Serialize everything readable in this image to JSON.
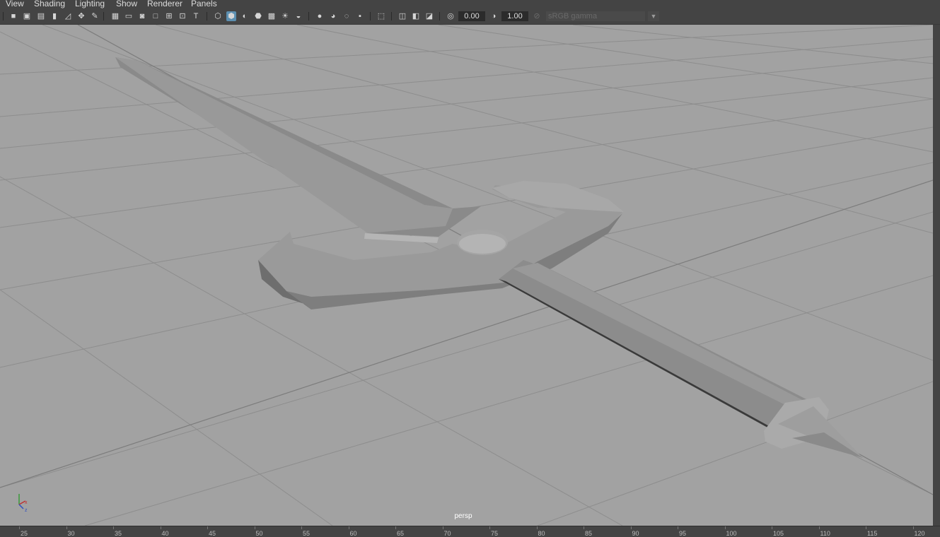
{
  "menu": {
    "view": "View",
    "shading": "Shading",
    "lighting": "Lighting",
    "show": "Show",
    "renderer": "Renderer",
    "panels": "Panels"
  },
  "toolbar": {
    "exposure_value": "0.00",
    "gamma_value": "1.00",
    "color_space": "sRGB gamma",
    "active_colors": {
      "highlight": "#5c8fb0"
    }
  },
  "viewport": {
    "camera_label": "persp",
    "background": "#a2a2a2",
    "axis_labels": {
      "x": "x",
      "y": "y",
      "z": "z"
    }
  },
  "timeline": {
    "ticks": [
      "25",
      "30",
      "35",
      "40",
      "45",
      "50",
      "55",
      "60",
      "65",
      "70",
      "75",
      "80",
      "85",
      "90",
      "95",
      "100",
      "105",
      "110",
      "115",
      "120"
    ]
  }
}
